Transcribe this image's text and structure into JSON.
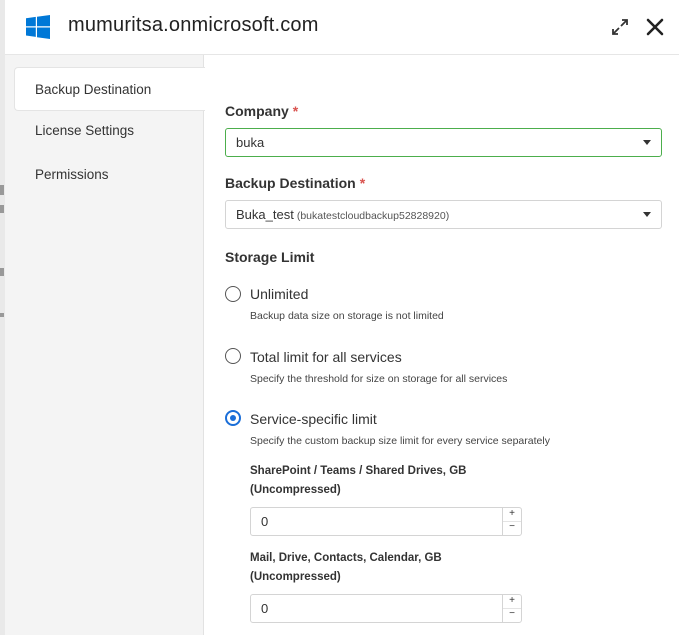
{
  "header": {
    "title": "mumuritsa.onmicrosoft.com",
    "logo_icon": "windows-logo-icon",
    "logo_color": "#0078d7",
    "expand_icon": "expand-diagonal-icon",
    "close_icon": "close-icon"
  },
  "sidebar": {
    "items": [
      {
        "label": "Backup Destination",
        "active": true
      },
      {
        "label": "License Settings",
        "active": false
      },
      {
        "label": "Permissions",
        "active": false
      }
    ]
  },
  "form": {
    "company": {
      "label": "Company",
      "required_mark": "*",
      "value": "buka"
    },
    "backup_destination": {
      "label": "Backup Destination",
      "required_mark": "*",
      "value": "Buka_test",
      "value_detail": "(bukatestcloudbackup52828920)"
    },
    "storage_limit": {
      "title": "Storage Limit",
      "options": [
        {
          "label": "Unlimited",
          "description": "Backup data size on storage is not limited",
          "checked": false
        },
        {
          "label": "Total limit for all services",
          "description": "Specify the threshold for size on storage for all services",
          "checked": false
        },
        {
          "label": "Service-specific limit",
          "description": "Specify the custom backup size limit for every service separately",
          "checked": true
        }
      ],
      "services": [
        {
          "label": "SharePoint / Teams / Shared Drives, GB (Uncompressed)",
          "value": "0"
        },
        {
          "label": "Mail, Drive, Contacts, Calendar, GB (Uncompressed)",
          "value": "0"
        }
      ]
    }
  },
  "colors": {
    "accent": "#1a6ed8",
    "required": "#d9534f",
    "focus_border": "#4cae4c"
  },
  "stepper": {
    "plus": "+",
    "minus": "−"
  }
}
